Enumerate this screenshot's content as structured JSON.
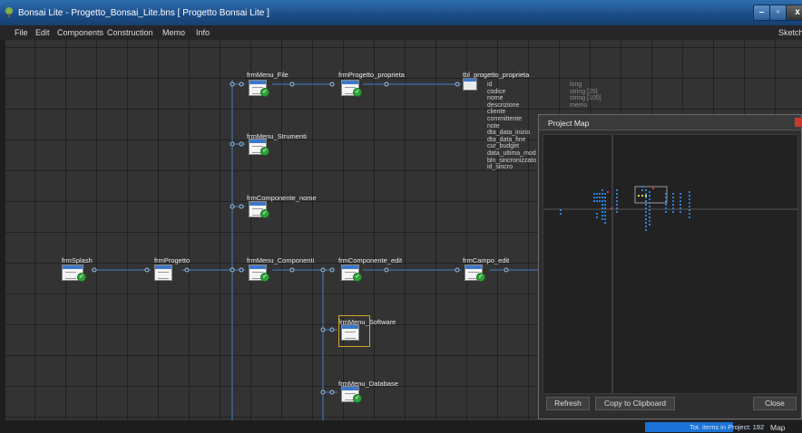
{
  "window": {
    "title": "Bonsai Lite  - Progetto_Bonsai_Lite.bns  [ Progetto Bonsai Lite ]",
    "min_glyph": "–",
    "max_glyph": "▫",
    "close_glyph": "x"
  },
  "menu": {
    "items": [
      "File",
      "Edit",
      "Components",
      "Construction",
      "Memo",
      "Info"
    ],
    "right": "Sketch"
  },
  "diagram": {
    "nodes": {
      "frmMenu_File": "frmMenu_File",
      "frmProgetto_proprieta": "frmProgetto_proprieta",
      "tbl_progetto_proprieta": "tbl_progetto_proprieta",
      "frmMenu_Strumenti": "frmMenu_Strumenti",
      "frmComponente_nome": "frmComponente_nome",
      "frmSplash": "frmSplash",
      "frmProgetto": "frmProgetto",
      "frmMenu_Componenti": "frmMenu_Componenti",
      "frmComponente_edit": "frmComponente_edit",
      "frmCampo_edit": "frmCampo_edit",
      "frmMenu_Software": "frmMenu_Software",
      "frmMenu_Database": "frmMenu_Database"
    },
    "table_fields": [
      "id",
      "codice",
      "nome",
      "descrizione",
      "cliente",
      "committente",
      "note",
      "dta_data_inizio",
      "dta_data_fine",
      "cur_budget",
      "data_ultima_mod",
      "bln_sincronizzato",
      "id_sincro"
    ],
    "table_types": [
      "long",
      "string [25]",
      "string [100]",
      "memo"
    ]
  },
  "project_map": {
    "title": "Project Map",
    "refresh": "Refresh",
    "copy": "Copy to Clipboard",
    "close": "Close"
  },
  "status": {
    "items": "Tot. items in Project: 192",
    "map": "Map"
  },
  "colors": {
    "title_bar": "#1b4c86",
    "connector": "#3b82c9",
    "selection": "#d6a32c",
    "ok_badge": "#2ea43a",
    "map_dot": "#2f7fd8",
    "map_dot_alt": "#e8e04a",
    "map_dot_red": "#d83a3a",
    "progress": "#1a72d6"
  }
}
